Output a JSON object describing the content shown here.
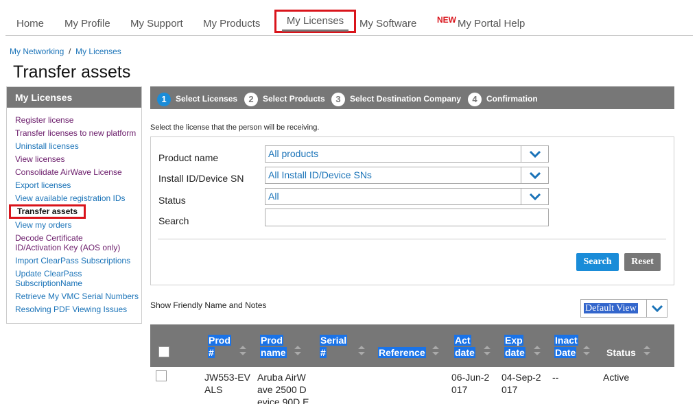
{
  "nav": {
    "items": [
      "Home",
      "My Profile",
      "My Support",
      "My Products",
      "My Licenses",
      "My Software",
      "My Portal Help"
    ],
    "new_badge": "NEW"
  },
  "breadcrumb": {
    "item1": "My Networking",
    "separator": "/",
    "item2": "My Licenses"
  },
  "page_title": "Transfer assets",
  "sidebar": {
    "title": "My Licenses",
    "items": [
      "Register license",
      "Transfer licenses to new platform",
      "Uninstall licenses",
      "View licenses",
      "Consolidate AirWave License",
      "Export licenses",
      "View available registration IDs",
      "Transfer assets",
      "View my orders",
      "Decode Certificate ID/Activation Key (AOS only)",
      "Import ClearPass Subscriptions",
      "Update ClearPass SubscriptionName",
      "Retrieve My VMC Serial Numbers",
      "Resolving PDF Viewing Issues"
    ]
  },
  "steps": [
    {
      "num": "1",
      "label": "Select Licenses"
    },
    {
      "num": "2",
      "label": "Select Products"
    },
    {
      "num": "3",
      "label": "Select Destination Company"
    },
    {
      "num": "4",
      "label": "Confirmation"
    }
  ],
  "instruction": "Select the license that the person will be receiving.",
  "filters": {
    "product_label": "Product name",
    "product_value": "All products",
    "install_label": "Install ID/Device SN",
    "install_value": "All Install ID/Device SNs",
    "status_label": "Status",
    "status_value": "All",
    "search_label": "Search",
    "search_value": ""
  },
  "buttons": {
    "search": "Search",
    "reset": "Reset"
  },
  "friendly_label": "Show Friendly Name and Notes",
  "view_select": "Default View",
  "table": {
    "headers": {
      "prod_num_1": "Prod",
      "prod_num_2": "#",
      "prod_name_1": "Prod",
      "prod_name_2": "name",
      "serial_1": "Serial",
      "serial_2": "#",
      "reference": "Reference",
      "act_1": "Act",
      "act_2": "date",
      "exp_1": "Exp",
      "exp_2": "date",
      "inact_1": "Inact",
      "inact_2": "Date",
      "status": "Status"
    },
    "row": {
      "prod_num_1": "JW553-EV",
      "prod_num_2": "ALS",
      "prod_name_1": "Aruba AirW",
      "prod_name_2": "ave 2500 D",
      "prod_name_3": "evice 90D E",
      "act_1": "06-Jun-2",
      "act_2": "017",
      "exp_1": "04-Sep-2",
      "exp_2": "017",
      "inact": "--",
      "status": "Active"
    }
  },
  "colors": {
    "accent": "#1a8cd8",
    "highlight_border": "#d9141b",
    "header_gray": "#777777",
    "link": "#1a73b8"
  }
}
